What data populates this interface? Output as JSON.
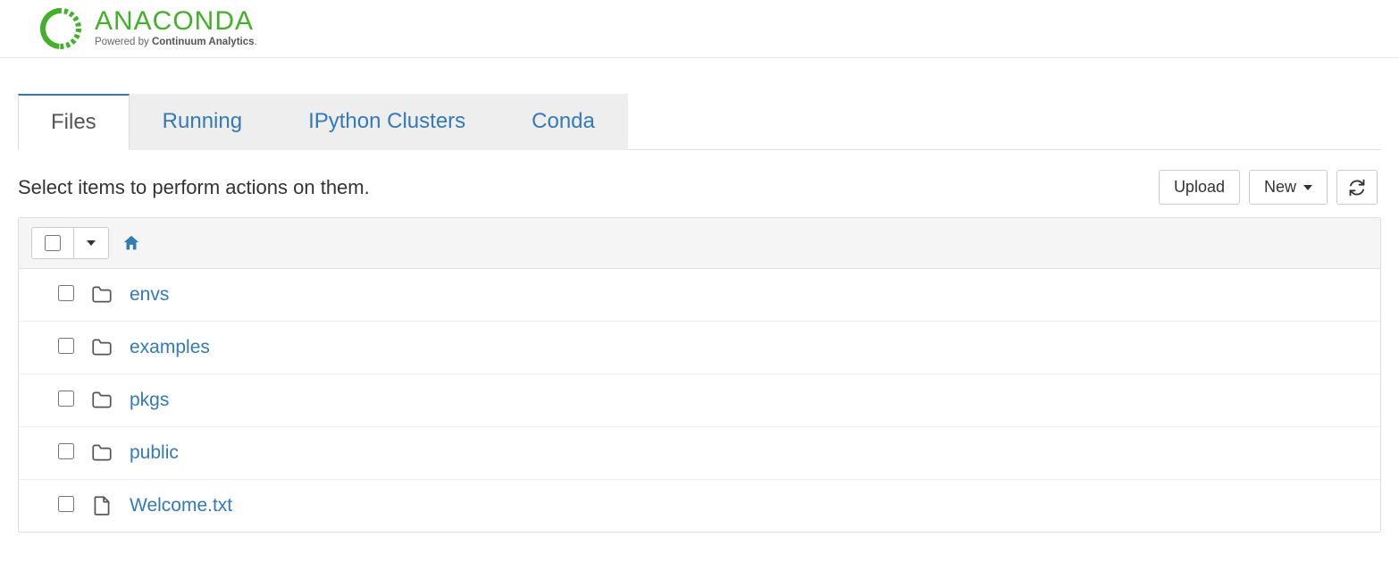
{
  "brand": {
    "name": "ANACONDA",
    "tagline_prefix": "Powered by ",
    "tagline_bold": "Continuum Analytics",
    "tagline_suffix": "."
  },
  "tabs": [
    {
      "label": "Files",
      "active": true
    },
    {
      "label": "Running",
      "active": false
    },
    {
      "label": "IPython Clusters",
      "active": false
    },
    {
      "label": "Conda",
      "active": false
    }
  ],
  "toolbar": {
    "message": "Select items to perform actions on them.",
    "upload_label": "Upload",
    "new_label": "New"
  },
  "items": [
    {
      "name": "envs",
      "type": "folder"
    },
    {
      "name": "examples",
      "type": "folder"
    },
    {
      "name": "pkgs",
      "type": "folder"
    },
    {
      "name": "public",
      "type": "folder"
    },
    {
      "name": "Welcome.txt",
      "type": "file"
    }
  ]
}
